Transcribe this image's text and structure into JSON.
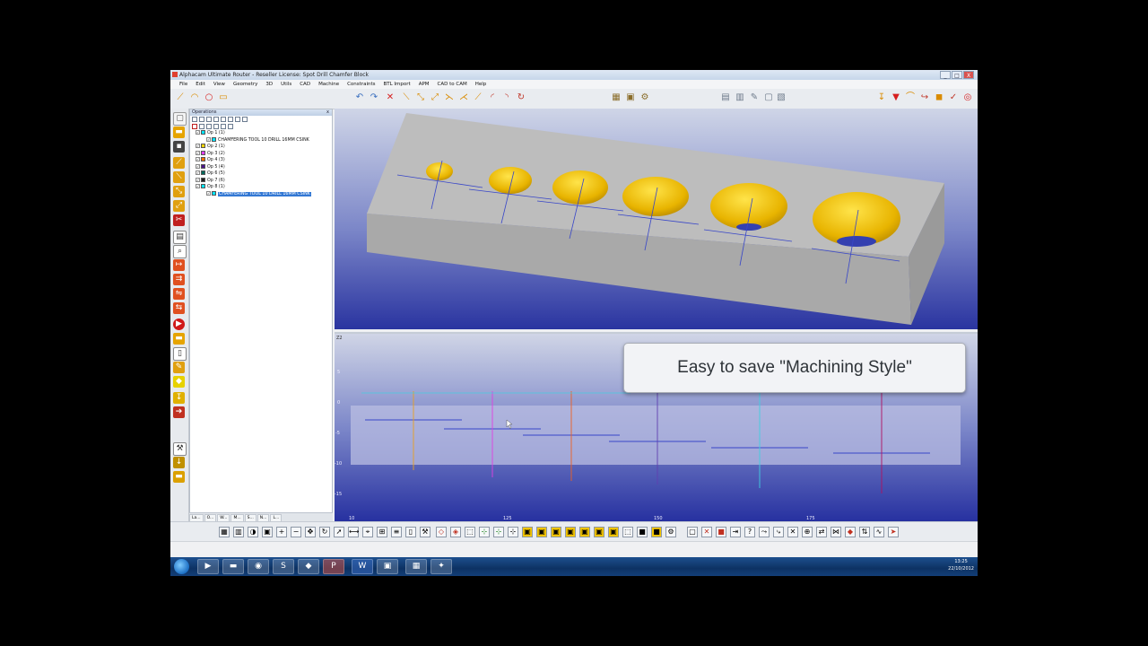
{
  "window": {
    "title": "Alphacam Ultimate Router - Reseller License: Spot Drill Chamfer Block",
    "minimize": "_",
    "maximize": "□",
    "close": "X"
  },
  "menu": [
    "File",
    "Edit",
    "View",
    "Geometry",
    "3D",
    "Utils",
    "CAD",
    "Machine",
    "Constraints",
    "BTL Import",
    "APM",
    "CAD to CAM",
    "Help"
  ],
  "operations_panel": {
    "title": "Operations",
    "close": "x",
    "rows": [
      {
        "label": "Op 1  (1)",
        "color": "#00e5ff",
        "indent": 0
      },
      {
        "label": "CHAMFERING   TOOL 10   DRILL 16MM CSINK",
        "color": "#00e5ff",
        "indent": 1
      },
      {
        "label": "Op 2  (1)",
        "color": "#ffd600",
        "indent": 0
      },
      {
        "label": "Op 3  (2)",
        "color": "#e040fb",
        "indent": 0
      },
      {
        "label": "Op 4  (3)",
        "color": "#ff6d00",
        "indent": 0
      },
      {
        "label": "Op 5  (4)",
        "color": "#4a148c",
        "indent": 0
      },
      {
        "label": "Op 6  (5)",
        "color": "#00695c",
        "indent": 0
      },
      {
        "label": "Op 7  (6)",
        "color": "#212121",
        "indent": 0
      },
      {
        "label": "Op 8  (1)",
        "color": "#00e5ff",
        "indent": 0
      },
      {
        "label": "CHAMFERING   TOOL 10   DRILL 16MM CSINK",
        "color": "#00e5ff",
        "indent": 1,
        "selected": true
      }
    ],
    "tabs": [
      "La...",
      "O...",
      "W...",
      "M...",
      "S...",
      "N...",
      "L..."
    ]
  },
  "view2d": {
    "label": "Z2",
    "y_ticks": [
      "5",
      "0",
      "-5",
      "-10",
      "-15"
    ],
    "x_ticks": [
      "10",
      "125",
      "150",
      "175"
    ]
  },
  "tip": {
    "text": "Easy to save \"Machining Style\""
  },
  "taskbar": {
    "time": "13:25",
    "date": "22/10/2012"
  },
  "colors": {
    "viewport_top": "#cdd4e6",
    "viewport_bottom": "#2633a0",
    "block_face": "#bdbdbd",
    "hole_gold": "#f2c400"
  }
}
